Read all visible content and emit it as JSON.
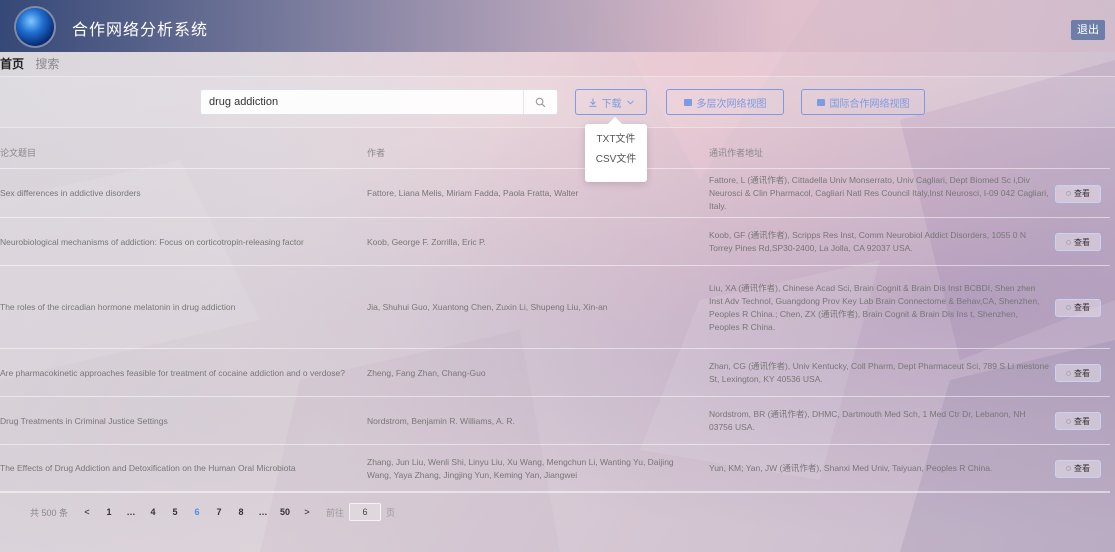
{
  "header": {
    "title": "合作网络分析系统",
    "logout_label": "退出"
  },
  "breadcrumb": {
    "home": "首页",
    "search": "搜索"
  },
  "search": {
    "value": "drug addiction"
  },
  "toolbar": {
    "download_label": "下载",
    "multi_level_label": "多层次网络视图",
    "international_label": "国际合作网络视图"
  },
  "download_menu": {
    "items": [
      "TXT文件",
      "CSV文件"
    ]
  },
  "table": {
    "headers": {
      "title": "论文题目",
      "author": "作者",
      "address": "通讯作者地址"
    },
    "view_label": "查看",
    "rows": [
      {
        "title": "Sex differences in addictive disorders",
        "authors": "Fattore, Liana Melis, Miriam Fadda, Paola Fratta, Walter",
        "address": "Fattore, L (通讯作者), Cittadella Univ Monserrato, Univ Cagliari, Dept Biomed Sc i,Div Neurosci & Clin Pharmacol, Cagliari Natl Res Council Italy,Inst Neurosci, I-09 042 Cagliari, Italy."
      },
      {
        "title": "Neurobiological mechanisms of addiction: Focus on corticotropin-releasing factor",
        "authors": "Koob, George F. Zorrilla, Eric P.",
        "address": "Koob, GF (通讯作者), Scripps Res Inst, Comm Neurobiol Addict Disorders, 1055 0 N Torrey Pines Rd,SP30-2400, La Jolla, CA 92037 USA."
      },
      {
        "title": "The roles of the circadian hormone melatonin in drug addiction",
        "authors": "Jia, Shuhui Guo, Xuantong Chen, Zuxin Li, Shupeng Liu, Xin-an",
        "address": "Liu, XA (通讯作者), Chinese Acad Sci, Brain Cognit & Brain Dis Inst BCBDI, Shen zhen Inst Adv Technol, Guangdong Prov Key Lab Brain Connectome & Behav,CA, Shenzhen, Peoples R China.; Chen, ZX (通讯作者), Brain Cognit & Brain Dis Ins t, Shenzhen, Peoples R China."
      },
      {
        "title": "Are pharmacokinetic approaches feasible for treatment of cocaine addiction and o verdose?",
        "authors": "Zheng, Fang Zhan, Chang-Guo",
        "address": "Zhan, CG (通讯作者), Univ Kentucky, Coll Pharm, Dept Pharmaceut Sci, 789 S Li mestone St, Lexington, KY 40536 USA."
      },
      {
        "title": "Drug Treatments in Criminal Justice Settings",
        "authors": "Nordstrom, Benjamin R. Williams, A. R.",
        "address": "Nordstrom, BR (通讯作者), DHMC, Dartmouth Med Sch, 1 Med Ctr Dr, Lebanon, NH 03756 USA."
      },
      {
        "title": "The Effects of Drug Addiction and Detoxification on the Human Oral Microbiota",
        "authors": "Zhang, Jun Liu, Wenli Shi, Linyu Liu, Xu Wang, Mengchun Li, Wanting Yu, Daijing Wang, Yaya Zhang, Jingjing Yun, Keming Yan, Jiangwei",
        "address": "Yun, KM; Yan, JW (通讯作者), Shanxi Med Univ, Taiyuan, Peoples R China."
      }
    ]
  },
  "pagination": {
    "total": "共 500 条",
    "prev": "<",
    "next": ">",
    "pages": [
      "1",
      "…",
      "4",
      "5",
      "6",
      "7",
      "8",
      "…",
      "50"
    ],
    "current": "6",
    "goto_label": "前往",
    "goto_value": "6",
    "page_suffix": "页"
  }
}
